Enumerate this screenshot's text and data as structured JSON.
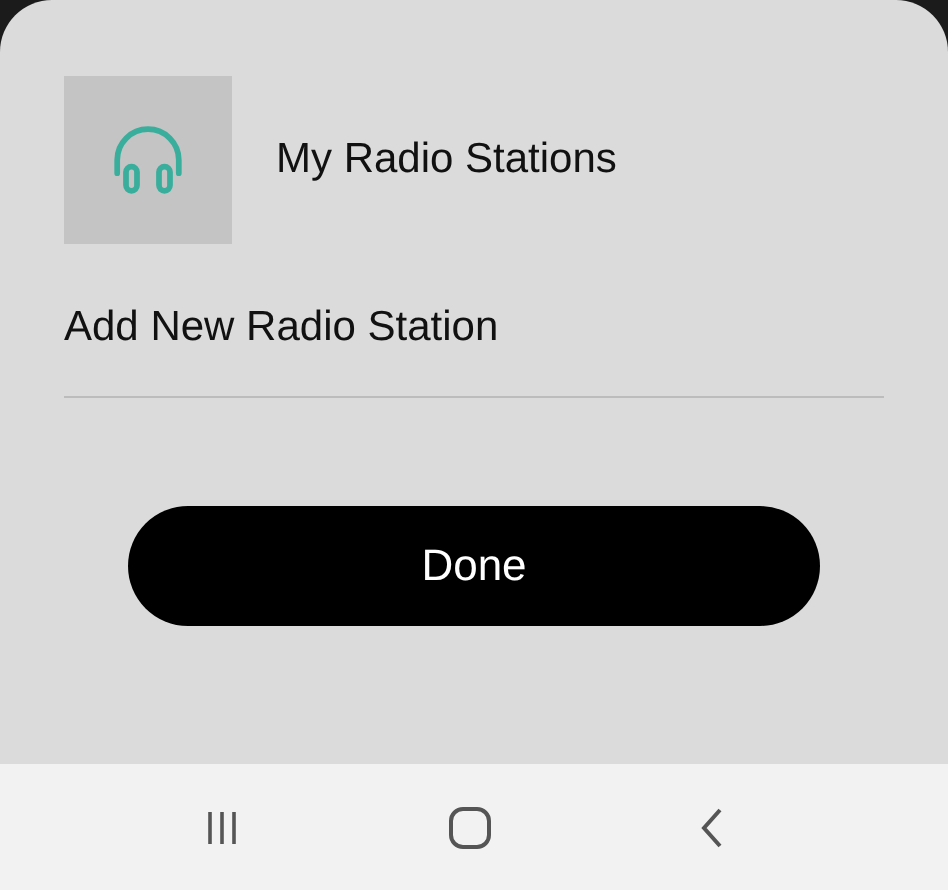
{
  "header": {
    "title": "My Radio Stations"
  },
  "menu_items": [
    {
      "label": "Add New Radio Station"
    }
  ],
  "buttons": [
    {
      "label": "Done"
    }
  ]
}
